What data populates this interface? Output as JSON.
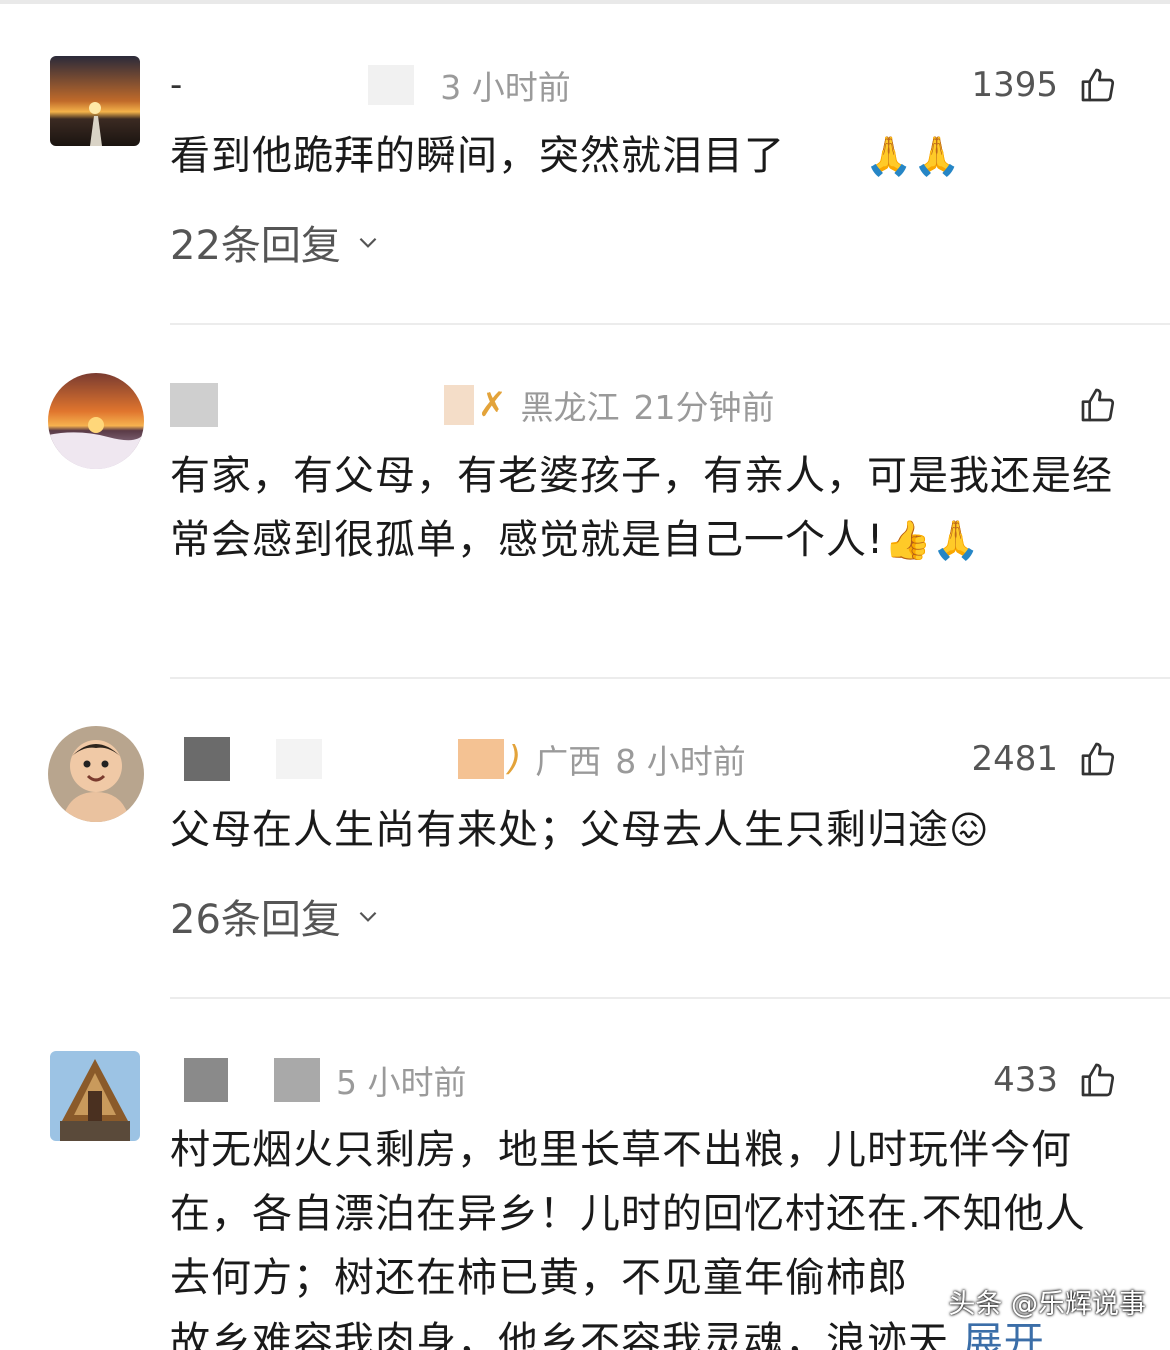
{
  "comments": [
    {
      "name": "-",
      "region": "",
      "time": "3 小时前",
      "likes": "1395",
      "text": "看到他跪拜的瞬间，突然就泪目了",
      "emoji": "🙏🙏",
      "replies": "22条回复"
    },
    {
      "name": "",
      "region": "黑龙江",
      "time": "21分钟前",
      "likes": "",
      "text": "有家，有父母，有老婆孩子，有亲人，可是我还是经常会感到很孤单，感觉就是自己一个人!",
      "emoji": "👍🙏",
      "replies": ""
    },
    {
      "name": "",
      "region": "广西",
      "time": "8 小时前",
      "likes": "2481",
      "text": "父母在人生尚有来处；父母去人生只剩归途",
      "emoji": "😖",
      "replies": "26条回复"
    },
    {
      "name": "",
      "region": "",
      "time": "5 小时前",
      "likes": "433",
      "text": "村无烟火只剩房，地里长草不出粮，儿时玩伴今何在，各自漂泊在异乡！儿时的回忆村还在.不知他人去何方；树还在柿已黄，不见童年偷柿郎",
      "text_cut": "故乡难容我肉身，他乡不容我灵魂，浪迹天",
      "expand": "展开",
      "replies": ""
    }
  ],
  "watermark": "头条 @乐辉说事",
  "colors": {
    "accent": "#3b6ea8",
    "vip": "#e3a33a",
    "muted": "#9a9a9a"
  }
}
